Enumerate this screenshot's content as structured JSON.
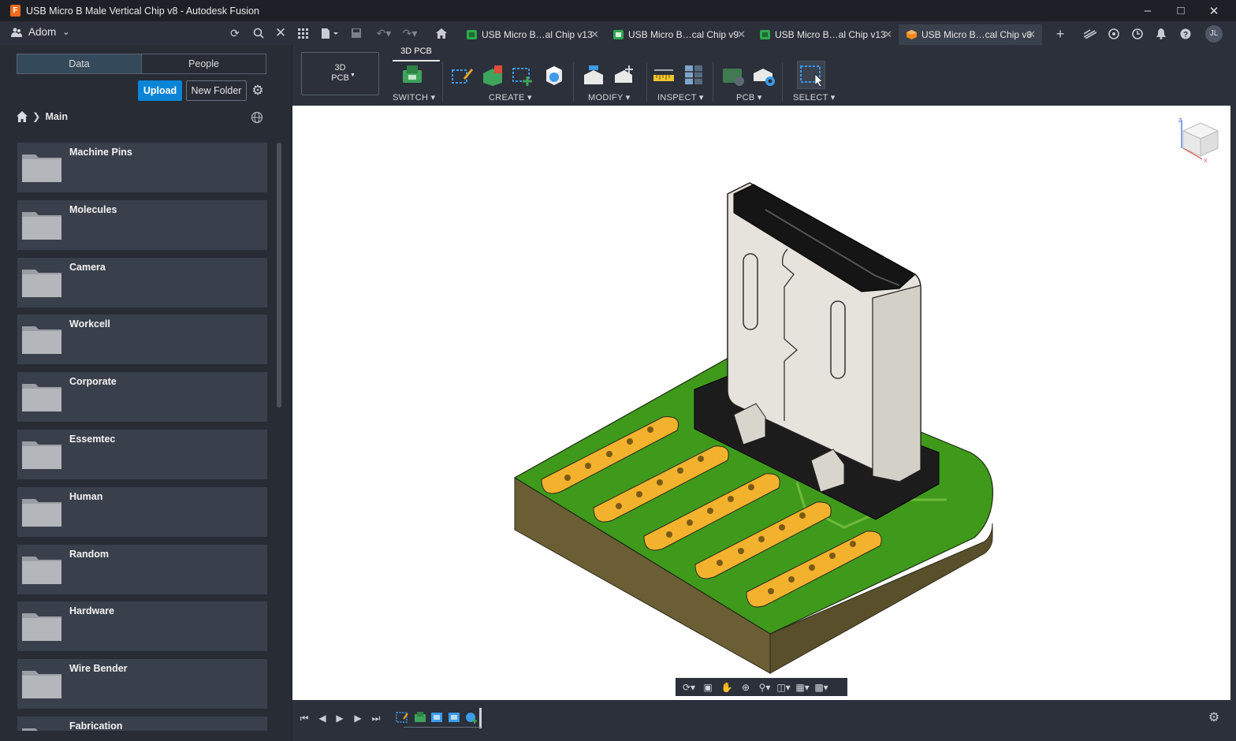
{
  "window": {
    "title": "USB Micro B Male Vertical Chip v8 - Autodesk Fusion",
    "controls": [
      "minimize-icon",
      "maximize-icon",
      "close-icon"
    ]
  },
  "topbar": {
    "team": "Adom",
    "tabs": [
      {
        "label": "USB Micro B…al Chip v13",
        "type": "pcb",
        "active": false
      },
      {
        "label": "USB Micro B…cal Chip v9",
        "type": "pcb",
        "active": false
      },
      {
        "label": "USB Micro B…al Chip v13",
        "type": "pcb",
        "active": false
      },
      {
        "label": "USB Micro B…cal Chip v8",
        "type": "3d",
        "active": true
      }
    ],
    "avatar": "JL"
  },
  "data_panel": {
    "segments": [
      "Data",
      "People"
    ],
    "active_segment": "Data",
    "upload": "Upload",
    "new_folder": "New Folder",
    "breadcrumb": "Main",
    "folders": [
      "Machine Pins",
      "Molecules",
      "Camera",
      "Workcell",
      "Corporate",
      "Essemtec",
      "Human",
      "Random",
      "Hardware",
      "Wire Bender",
      "Fabrication"
    ]
  },
  "toolbar": {
    "workspace": "3D\nPCB",
    "workspace_line1": "3D",
    "workspace_line2": "PCB",
    "active_tab": "3D PCB",
    "groups": [
      "SWITCH",
      "CREATE",
      "MODIFY",
      "INSPECT",
      "PCB",
      "SELECT"
    ]
  },
  "colors": {
    "accent": "#0a84d6",
    "board_green": "#3f9a1c",
    "pad_orange": "#f3b22d",
    "board_core": "#6b5e35",
    "connector_shell": "#e6e3dc",
    "connector_plastic": "#1a1a1a"
  }
}
